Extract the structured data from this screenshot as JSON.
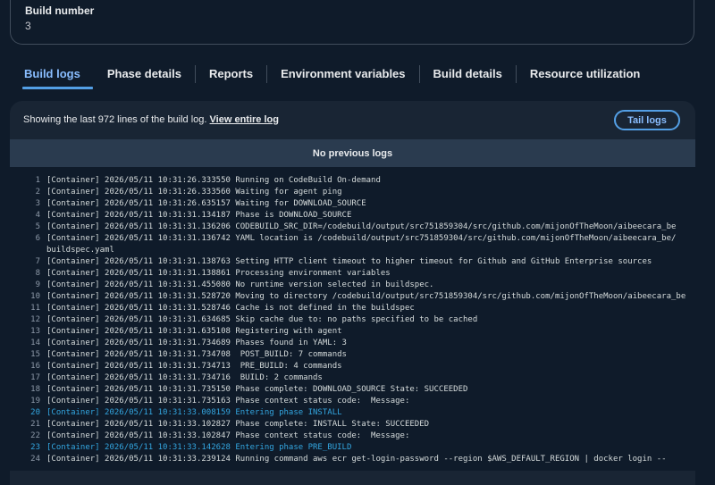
{
  "build": {
    "label": "Build number",
    "value": "3"
  },
  "tabs": [
    {
      "label": "Build logs"
    },
    {
      "label": "Phase details"
    },
    {
      "label": "Reports"
    },
    {
      "label": "Environment variables"
    },
    {
      "label": "Build details"
    },
    {
      "label": "Resource utilization"
    }
  ],
  "log_panel": {
    "info_prefix": "Showing the last 972 lines of the build log. ",
    "view_entire_link": "View entire log",
    "tail_button": "Tail logs",
    "no_previous": "No previous logs",
    "lines": [
      {
        "n": "1",
        "text": "[Container] 2026/05/11 10:31:26.333550 Running on CodeBuild On-demand",
        "hl": false
      },
      {
        "n": "2",
        "text": "[Container] 2026/05/11 10:31:26.333560 Waiting for agent ping",
        "hl": false
      },
      {
        "n": "3",
        "text": "[Container] 2026/05/11 10:31:26.635157 Waiting for DOWNLOAD_SOURCE",
        "hl": false
      },
      {
        "n": "4",
        "text": "[Container] 2026/05/11 10:31:31.134187 Phase is DOWNLOAD_SOURCE",
        "hl": false
      },
      {
        "n": "5",
        "text": "[Container] 2026/05/11 10:31:31.136206 CODEBUILD_SRC_DIR=/codebuild/output/src751859304/src/github.com/mijonOfTheMoon/aibeecara_be",
        "hl": false
      },
      {
        "n": "6",
        "text": "[Container] 2026/05/11 10:31:31.136742 YAML location is /codebuild/output/src751859304/src/github.com/mijonOfTheMoon/aibeecara_be/",
        "hl": false
      },
      {
        "n": "",
        "text": "buildspec.yaml",
        "hl": false
      },
      {
        "n": "7",
        "text": "[Container] 2026/05/11 10:31:31.138763 Setting HTTP client timeout to higher timeout for Github and GitHub Enterprise sources",
        "hl": false
      },
      {
        "n": "8",
        "text": "[Container] 2026/05/11 10:31:31.138861 Processing environment variables",
        "hl": false
      },
      {
        "n": "9",
        "text": "[Container] 2026/05/11 10:31:31.455080 No runtime version selected in buildspec.",
        "hl": false
      },
      {
        "n": "10",
        "text": "[Container] 2026/05/11 10:31:31.528720 Moving to directory /codebuild/output/src751859304/src/github.com/mijonOfTheMoon/aibeecara_be",
        "hl": false
      },
      {
        "n": "11",
        "text": "[Container] 2026/05/11 10:31:31.528746 Cache is not defined in the buildspec",
        "hl": false
      },
      {
        "n": "12",
        "text": "[Container] 2026/05/11 10:31:31.634685 Skip cache due to: no paths specified to be cached",
        "hl": false
      },
      {
        "n": "13",
        "text": "[Container] 2026/05/11 10:31:31.635108 Registering with agent",
        "hl": false
      },
      {
        "n": "14",
        "text": "[Container] 2026/05/11 10:31:31.734689 Phases found in YAML: 3",
        "hl": false
      },
      {
        "n": "15",
        "text": "[Container] 2026/05/11 10:31:31.734708  POST_BUILD: 7 commands",
        "hl": false
      },
      {
        "n": "16",
        "text": "[Container] 2026/05/11 10:31:31.734713  PRE_BUILD: 4 commands",
        "hl": false
      },
      {
        "n": "17",
        "text": "[Container] 2026/05/11 10:31:31.734716  BUILD: 2 commands",
        "hl": false
      },
      {
        "n": "18",
        "text": "[Container] 2026/05/11 10:31:31.735150 Phase complete: DOWNLOAD_SOURCE State: SUCCEEDED",
        "hl": false
      },
      {
        "n": "19",
        "text": "[Container] 2026/05/11 10:31:31.735163 Phase context status code:  Message:",
        "hl": false
      },
      {
        "n": "20",
        "text": "[Container] 2026/05/11 10:31:33.008159 Entering phase INSTALL",
        "hl": true
      },
      {
        "n": "21",
        "text": "[Container] 2026/05/11 10:31:33.102827 Phase complete: INSTALL State: SUCCEEDED",
        "hl": false
      },
      {
        "n": "22",
        "text": "[Container] 2026/05/11 10:31:33.102847 Phase context status code:  Message:",
        "hl": false
      },
      {
        "n": "23",
        "text": "[Container] 2026/05/11 10:31:33.142628 Entering phase PRE_BUILD",
        "hl": true
      },
      {
        "n": "24",
        "text": "[Container] 2026/05/11 10:31:33.239124 Running command aws ecr get-login-password --region $AWS_DEFAULT_REGION | docker login --",
        "hl": false
      }
    ]
  }
}
